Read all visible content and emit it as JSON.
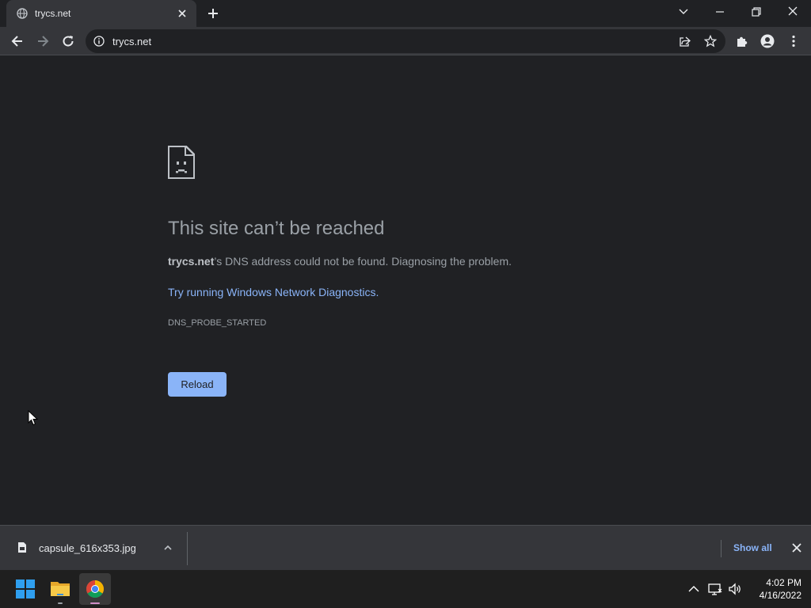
{
  "tab": {
    "title": "trycs.net"
  },
  "omnibox": {
    "url": "trycs.net"
  },
  "error": {
    "heading": "This site can’t be reached",
    "host": "trycs.net",
    "message_suffix": "’s DNS address could not be found. Diagnosing the problem.",
    "suggestion": "Try running Windows Network Diagnostics.",
    "code": "DNS_PROBE_STARTED",
    "reload_label": "Reload"
  },
  "download": {
    "filename": "capsule_616x353.jpg",
    "show_all_label": "Show all"
  },
  "clock": {
    "time": "4:02 PM",
    "date": "4/16/2022"
  },
  "icons": {
    "tab": "globe-icon",
    "nav": [
      "back-arrow-icon",
      "forward-arrow-icon",
      "reload-icon"
    ],
    "omnibox": [
      "info-icon",
      "share-icon",
      "star-icon"
    ],
    "toolbar": [
      "extensions-icon",
      "profile-icon",
      "menu-icon"
    ],
    "taskbar": [
      "windows-start-icon",
      "file-explorer-icon",
      "chrome-icon"
    ],
    "tray": [
      "chevron-up-icon",
      "network-icon",
      "volume-icon"
    ]
  },
  "colors": {
    "accent": "#8ab4f8",
    "page_bg": "#202124",
    "toolbar_bg": "#35363a"
  }
}
